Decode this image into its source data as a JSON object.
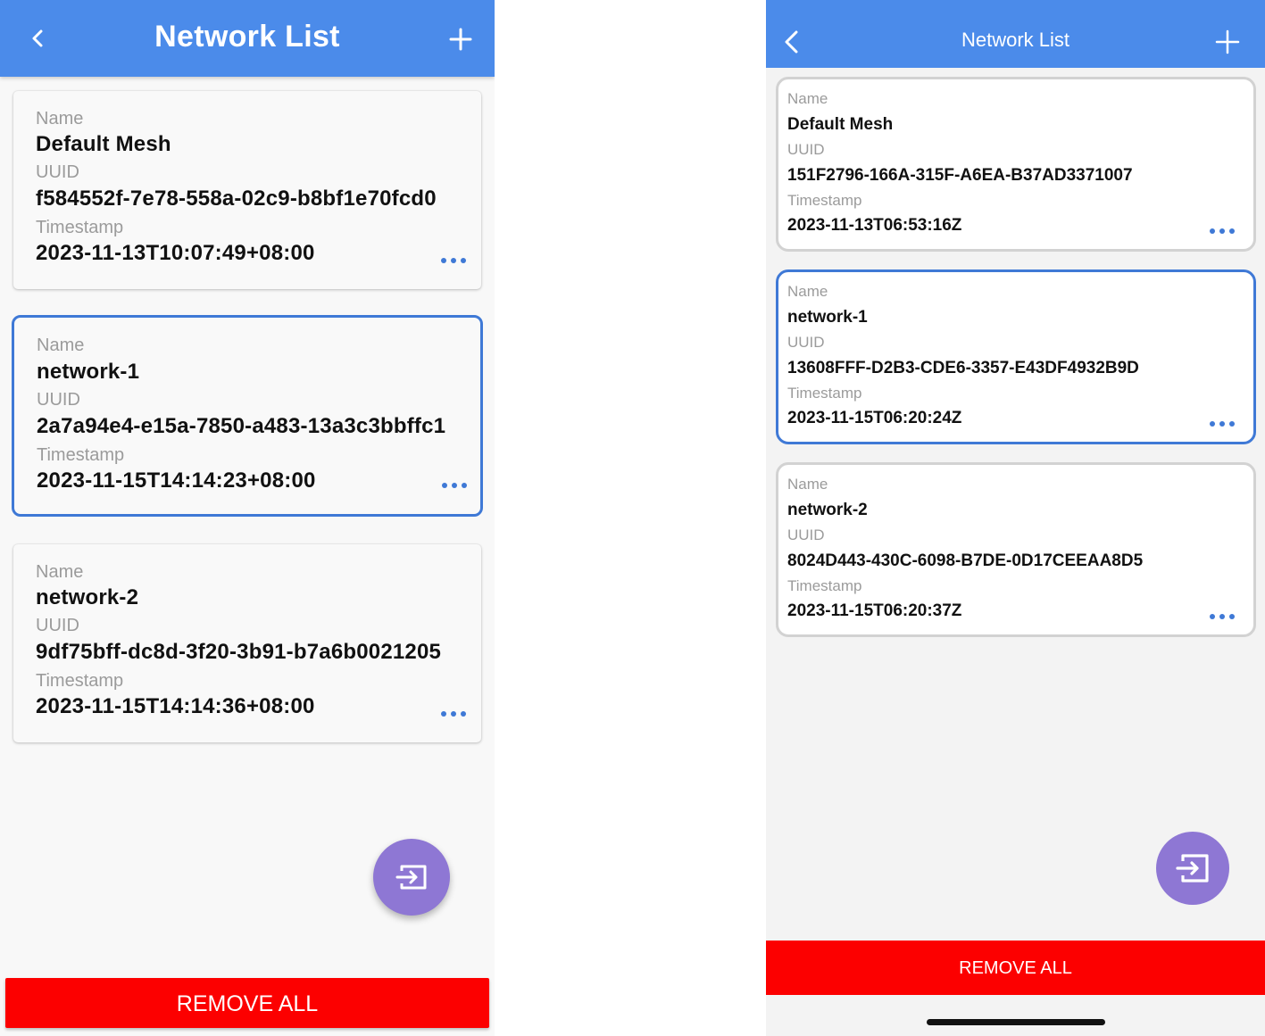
{
  "android": {
    "header": {
      "title": "Network List",
      "back_icon": "chevron-left-icon",
      "add_icon": "plus-icon"
    },
    "labels": {
      "name": "Name",
      "uuid": "UUID",
      "timestamp": "Timestamp"
    },
    "networks": [
      {
        "name": "Default Mesh",
        "uuid": "f584552f-7e78-558a-02c9-b8bf1e70fcd0",
        "timestamp": "2023-11-13T10:07:49+08:00",
        "selected": false
      },
      {
        "name": "network-1",
        "uuid": "2a7a94e4-e15a-7850-a483-13a3c3bbffc1",
        "timestamp": "2023-11-15T14:14:23+08:00",
        "selected": true
      },
      {
        "name": "network-2",
        "uuid": "9df75bff-dc8d-3f20-3b91-b7a6b0021205",
        "timestamp": "2023-11-15T14:14:36+08:00",
        "selected": false
      }
    ],
    "fab_icon": "import-icon",
    "remove_all_label": "REMOVE ALL"
  },
  "ios": {
    "header": {
      "title": "Network List",
      "back_icon": "chevron-left-icon",
      "add_icon": "plus-icon"
    },
    "labels": {
      "name": "Name",
      "uuid": "UUID",
      "timestamp": "Timestamp"
    },
    "networks": [
      {
        "name": "Default Mesh",
        "uuid": "151F2796-166A-315F-A6EA-B37AD3371007",
        "timestamp": "2023-11-13T06:53:16Z",
        "selected": false
      },
      {
        "name": "network-1",
        "uuid": "13608FFF-D2B3-CDE6-3357-E43DF4932B9D",
        "timestamp": "2023-11-15T06:20:24Z",
        "selected": true
      },
      {
        "name": "network-2",
        "uuid": "8024D443-430C-6098-B7DE-0D17CEEAA8D5",
        "timestamp": "2023-11-15T06:20:37Z",
        "selected": false
      }
    ],
    "fab_icon": "import-icon",
    "remove_all_label": "REMOVE ALL"
  },
  "colors": {
    "header": "#4b8bea",
    "selected_border": "#3f79d6",
    "more_dots": "#3f79d6",
    "fab": "#8e77d4",
    "remove": "#fc0000"
  }
}
